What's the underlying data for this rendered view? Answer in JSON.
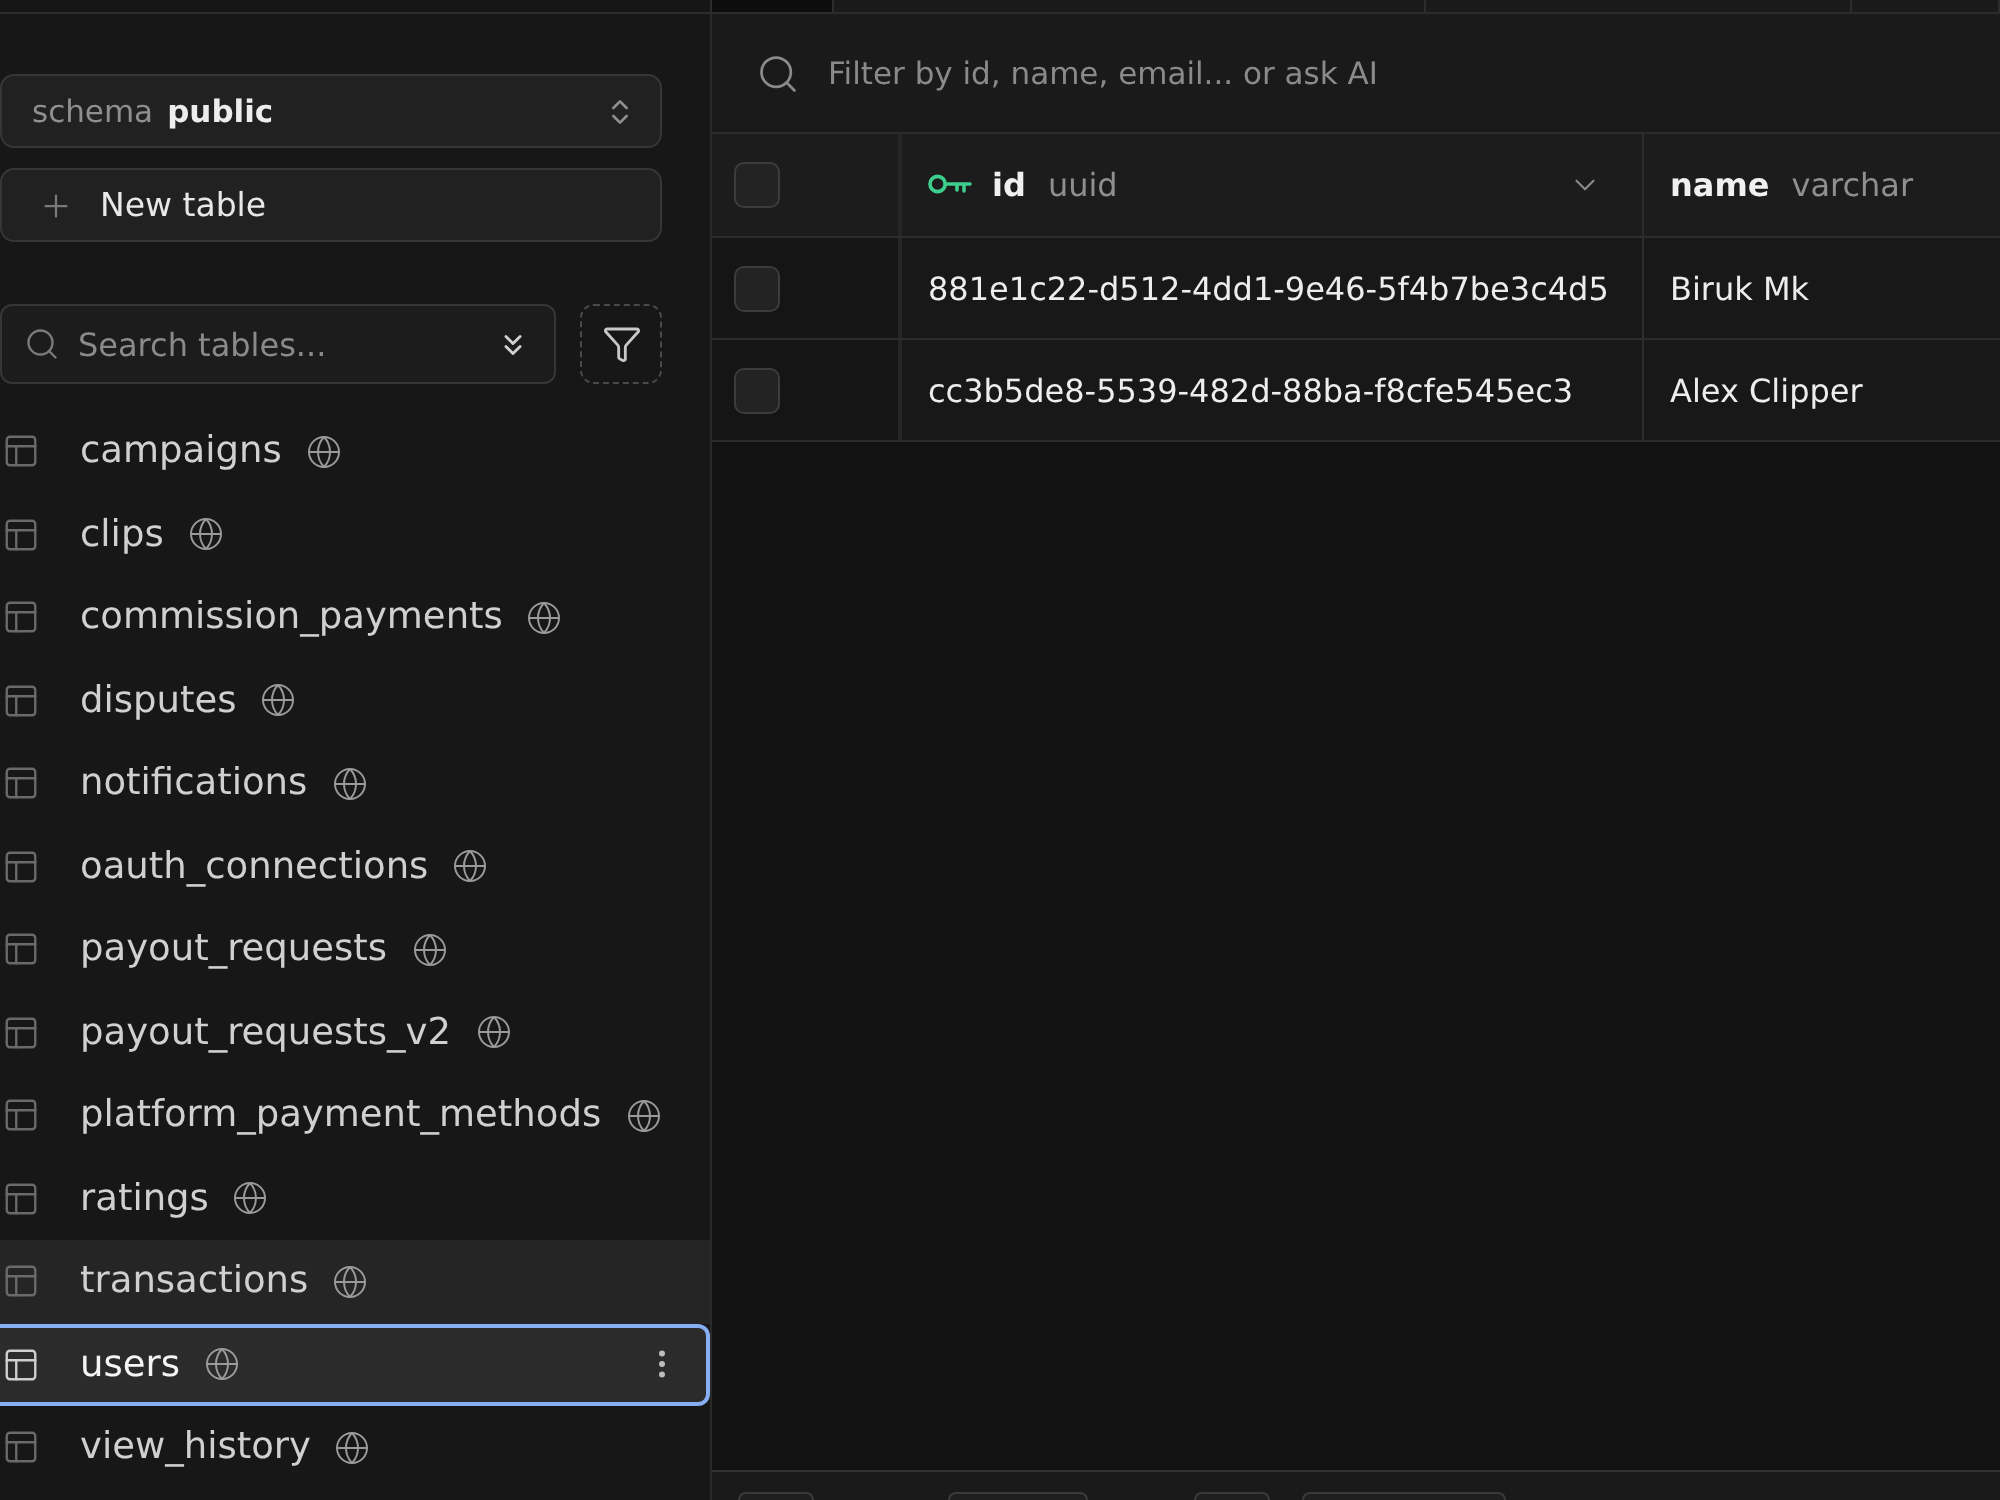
{
  "sidebar": {
    "schema_select": {
      "label": "schema",
      "value": "public"
    },
    "new_table_button": {
      "label": "New table"
    },
    "search": {
      "placeholder": "Search tables..."
    },
    "tables": [
      {
        "name": "campaigns",
        "selected": false,
        "hovered": false
      },
      {
        "name": "clips",
        "selected": false,
        "hovered": false
      },
      {
        "name": "commission_payments",
        "selected": false,
        "hovered": false
      },
      {
        "name": "disputes",
        "selected": false,
        "hovered": false
      },
      {
        "name": "notifications",
        "selected": false,
        "hovered": false
      },
      {
        "name": "oauth_connections",
        "selected": false,
        "hovered": false
      },
      {
        "name": "payout_requests",
        "selected": false,
        "hovered": false
      },
      {
        "name": "payout_requests_v2",
        "selected": false,
        "hovered": false
      },
      {
        "name": "platform_payment_methods",
        "selected": false,
        "hovered": false
      },
      {
        "name": "ratings",
        "selected": false,
        "hovered": false
      },
      {
        "name": "transactions",
        "selected": false,
        "hovered": true
      },
      {
        "name": "users",
        "selected": true,
        "hovered": false
      },
      {
        "name": "view_history",
        "selected": false,
        "hovered": false
      }
    ]
  },
  "grid": {
    "filter": {
      "placeholder": "Filter by id, name, email... or ask AI"
    },
    "select_all_checked": false,
    "columns": [
      {
        "name": "id",
        "type": "uuid",
        "kind": "primary_key",
        "hovered": true
      },
      {
        "name": "name",
        "type": "varchar",
        "kind": "plain",
        "hovered": false
      }
    ],
    "rows": [
      {
        "checked": false,
        "cells": [
          "881e1c22-d512-4dd1-9e46-5f4b7be3c4d5",
          "Biruk Mk"
        ]
      },
      {
        "checked": false,
        "cells": [
          "cc3b5de8-5539-482d-88ba-f8cfe545ec3",
          "Alex Clipper"
        ]
      }
    ]
  }
}
